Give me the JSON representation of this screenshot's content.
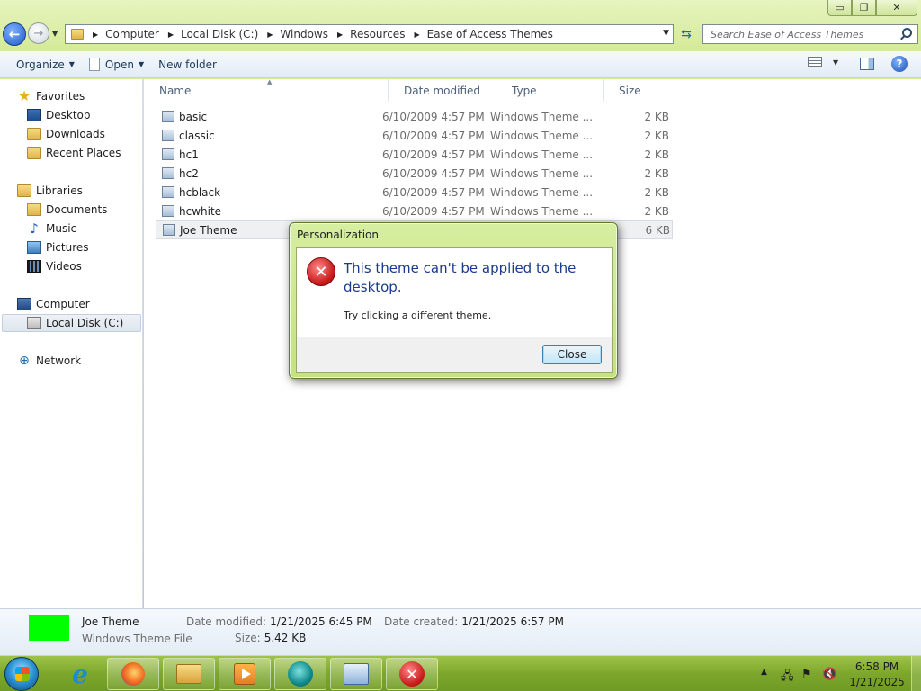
{
  "window": {
    "controls": {
      "minimize": "▭",
      "maximize": "❐",
      "close": "✕"
    }
  },
  "nav": {
    "back_glyph": "←",
    "forward_glyph": "→",
    "refresh_glyph": "⇆"
  },
  "address": {
    "breadcrumbs": [
      "Computer",
      "Local Disk (C:)",
      "Windows",
      "Resources",
      "Ease of Access Themes"
    ]
  },
  "search": {
    "placeholder": "Search Ease of Access Themes"
  },
  "toolbar": {
    "organize": "Organize",
    "open": "Open",
    "new_folder": "New folder",
    "help_glyph": "?"
  },
  "sidebar": {
    "favorites": "Favorites",
    "desktop": "Desktop",
    "downloads": "Downloads",
    "recent_places": "Recent Places",
    "libraries": "Libraries",
    "documents": "Documents",
    "music": "Music",
    "pictures": "Pictures",
    "videos": "Videos",
    "computer": "Computer",
    "local_disk": "Local Disk (C:)",
    "network": "Network"
  },
  "columns": {
    "name": "Name",
    "date_modified": "Date modified",
    "type": "Type",
    "size": "Size"
  },
  "files": [
    {
      "name": "basic",
      "date": "6/10/2009 4:57 PM",
      "type": "Windows Theme ...",
      "size": "2 KB"
    },
    {
      "name": "classic",
      "date": "6/10/2009 4:57 PM",
      "type": "Windows Theme ...",
      "size": "2 KB"
    },
    {
      "name": "hc1",
      "date": "6/10/2009 4:57 PM",
      "type": "Windows Theme ...",
      "size": "2 KB"
    },
    {
      "name": "hc2",
      "date": "6/10/2009 4:57 PM",
      "type": "Windows Theme ...",
      "size": "2 KB"
    },
    {
      "name": "hcblack",
      "date": "6/10/2009 4:57 PM",
      "type": "Windows Theme ...",
      "size": "2 KB"
    },
    {
      "name": "hcwhite",
      "date": "6/10/2009 4:57 PM",
      "type": "Windows Theme ...",
      "size": "2 KB"
    },
    {
      "name": "Joe Theme",
      "date": "",
      "type": "",
      "size": "6 KB"
    }
  ],
  "details": {
    "name": "Joe Theme",
    "type": "Windows Theme File",
    "date_modified_label": "Date modified:",
    "date_modified": "1/21/2025 6:45 PM",
    "date_created_label": "Date created:",
    "date_created": "1/21/2025 6:57 PM",
    "size_label": "Size:",
    "size": "5.42 KB",
    "thumbnail_color": "#00ff00"
  },
  "dialog": {
    "title": "Personalization",
    "message": "This theme can't be applied to the desktop.",
    "sub_message": "Try clicking a different theme.",
    "close_button": "Close",
    "icon": "error-icon"
  },
  "taskbar": {
    "clock_time": "6:58 PM",
    "clock_date": "1/21/2025",
    "ie_glyph": "e",
    "error_glyph": "✕",
    "tray_glyphs": {
      "flag": "⚑",
      "volume_muted": "🔇"
    }
  }
}
